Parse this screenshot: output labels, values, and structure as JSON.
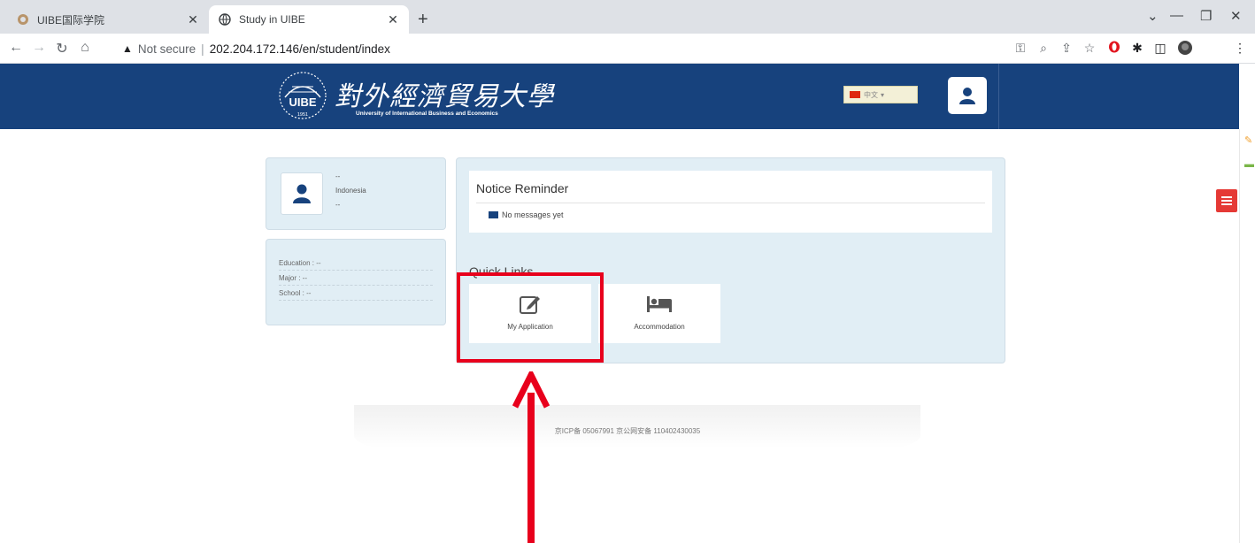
{
  "browser": {
    "tabs": [
      {
        "title": "UIBE国际学院",
        "active": false
      },
      {
        "title": "Study in UIBE",
        "active": true
      }
    ],
    "url": {
      "security_label": "Not secure",
      "address": "202.204.172.146/en/student/index"
    }
  },
  "header": {
    "logo_cn": "對外經濟貿易大學",
    "logo_en": "University of International Business and Economics",
    "logo_year": "1951",
    "logo_mark": "UIBE",
    "language": "中文"
  },
  "profile": {
    "name": "--",
    "country": "Indonesia",
    "extra": "--"
  },
  "info": {
    "rows": [
      "Education : --",
      "Major : --",
      "School : --"
    ]
  },
  "notice": {
    "title": "Notice Reminder",
    "message": "No messages yet"
  },
  "quick_links": {
    "title": "Quick Links",
    "items": [
      {
        "label": "My Application",
        "icon": "edit-icon"
      },
      {
        "label": "Accommodation",
        "icon": "bed-icon"
      }
    ]
  },
  "footer": {
    "text": "京ICP备 05067991 京公网安备 110402430035"
  },
  "colors": {
    "header_bg": "#17427d",
    "panel_bg": "#e1eef5",
    "menu_btn": "#e53935",
    "annotation": "#e8001c"
  }
}
